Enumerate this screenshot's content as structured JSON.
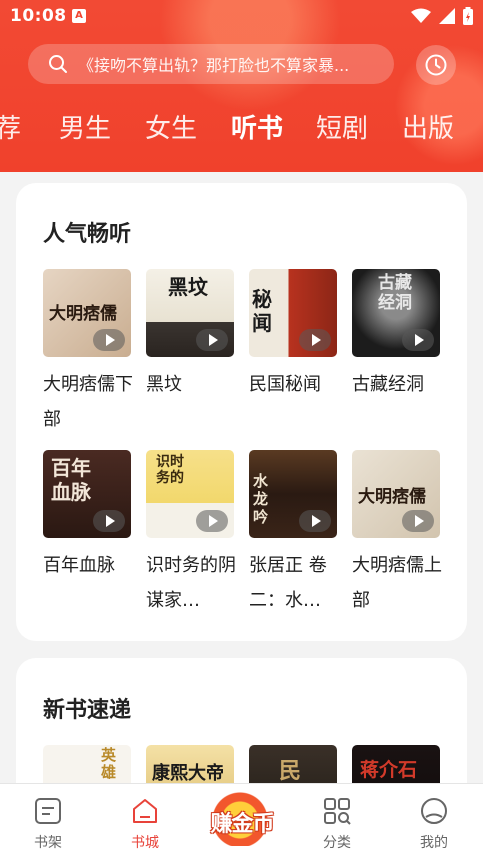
{
  "status_bar": {
    "time": "10:08",
    "notification_badge": "A"
  },
  "search": {
    "placeholder": "《接吻不算出轨？那打脸也不算家暴..."
  },
  "tabs": [
    "荐",
    "男生",
    "女生",
    "听书",
    "短剧",
    "出版"
  ],
  "active_tab": "听书",
  "sections": [
    {
      "title": "人气畅听",
      "books": [
        {
          "title": "大明痞儒下部",
          "cover_text": "大明痞儒"
        },
        {
          "title": "黑坟",
          "cover_text": "黑坟"
        },
        {
          "title": "民国秘闻",
          "cover_text": "秘闻"
        },
        {
          "title": "古藏经洞",
          "cover_text": "古藏经洞"
        },
        {
          "title": "百年血脉",
          "cover_text": "百年血脉"
        },
        {
          "title": "识时务的阴谋家…",
          "cover_text": "识时务的"
        },
        {
          "title": "张居正 卷二：水…",
          "cover_text": "水龙吟"
        },
        {
          "title": "大明痞儒上部",
          "cover_text": "大明痞儒"
        }
      ]
    },
    {
      "title": "新书速递",
      "books": [
        {
          "cover_text": "英雄"
        },
        {
          "cover_text": "康熙大帝"
        },
        {
          "cover_text": "民"
        },
        {
          "cover_text": "蒋介石"
        }
      ]
    }
  ],
  "bottom_nav": [
    {
      "label": "书架",
      "icon": "bookshelf-icon"
    },
    {
      "label": "书城",
      "icon": "bookstore-icon"
    },
    {
      "label": "赚金币",
      "icon": "earn-coins-icon"
    },
    {
      "label": "分类",
      "icon": "category-icon"
    },
    {
      "label": "我的",
      "icon": "profile-icon"
    }
  ],
  "colors": {
    "brand": "#f0412c",
    "active_nav": "#e8433a"
  }
}
